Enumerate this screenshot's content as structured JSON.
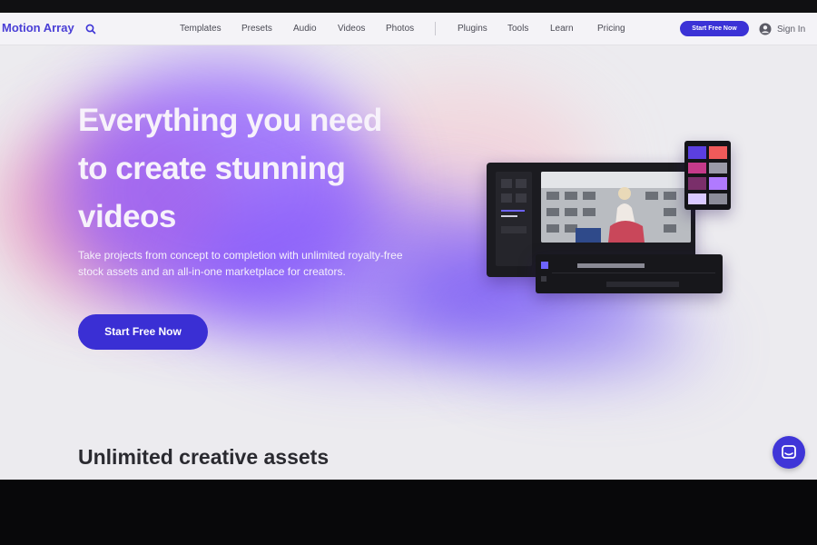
{
  "brand": {
    "name": "Motion Array",
    "accent": "#3b32d6"
  },
  "nav": {
    "links": [
      "Templates",
      "Presets",
      "Audio",
      "Videos",
      "Photos",
      "Plugins",
      "Tools",
      "Learn",
      "Pricing"
    ],
    "cta": "Start Free Now",
    "signin": "Sign In",
    "search_icon": "search-icon",
    "user_icon": "user-circle-icon"
  },
  "hero": {
    "headline": [
      "Everything you need",
      "to create stunning",
      "videos"
    ],
    "subtext": "Take projects from concept to completion with unlimited royalty-free stock assets and an all-in-one marketplace for creators.",
    "cta": "Start Free Now"
  },
  "section": {
    "title": "Unlimited creative assets"
  },
  "chat": {
    "icon": "chat-icon"
  }
}
